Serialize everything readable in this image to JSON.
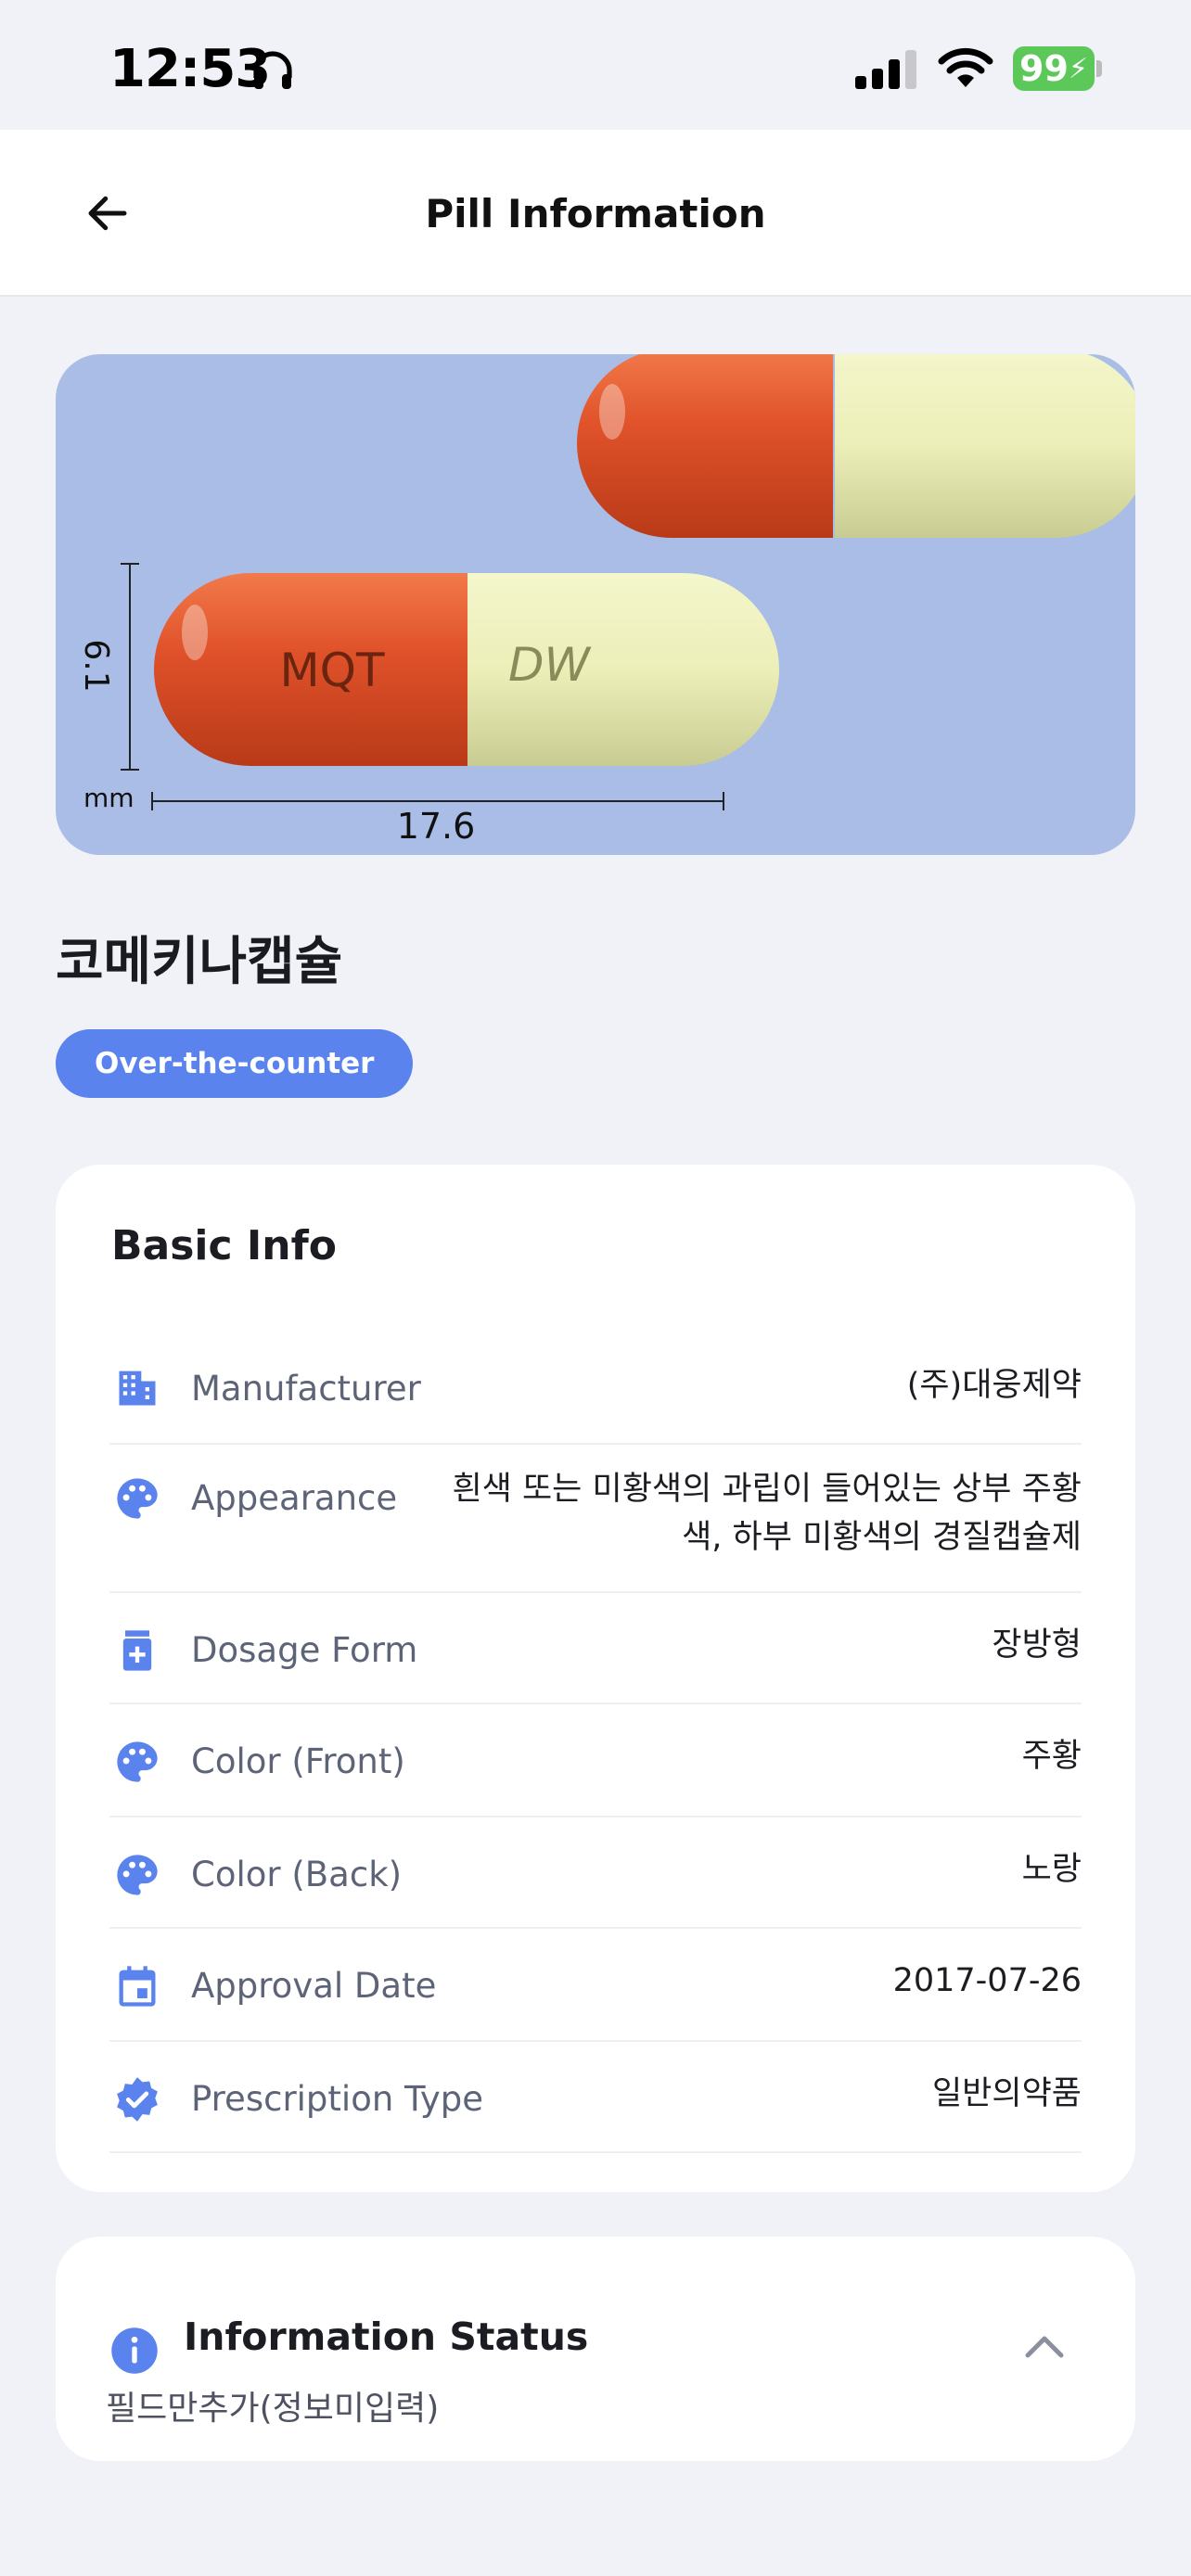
{
  "status_bar": {
    "time": "12:53",
    "battery": "99"
  },
  "nav": {
    "title": "Pill Information"
  },
  "pill_image": {
    "front_imprint": "MQT",
    "back_imprint": "DW",
    "height_dim": "6.1",
    "length_dim": "17.6",
    "unit": "mm",
    "color_front": "#e0522a",
    "color_back": "#ecefb8",
    "background": "#a9bde6"
  },
  "product": {
    "name": "코메키나캡슐",
    "badge": "Over-the-counter"
  },
  "basic_info": {
    "title": "Basic Info",
    "rows": [
      {
        "icon": "building-icon",
        "label": "Manufacturer",
        "value": "(주)대웅제약"
      },
      {
        "icon": "palette-icon",
        "label": "Appearance",
        "value_line1": "흰색 또는 미황색의 과립이 들어있는 상부 주황",
        "value_line2": "색, 하부 미황색의 경질캡슐제"
      },
      {
        "icon": "medicine-bottle-icon",
        "label": "Dosage Form",
        "value": "장방형"
      },
      {
        "icon": "palette-icon",
        "label": "Color (Front)",
        "value": "주황"
      },
      {
        "icon": "palette-icon",
        "label": "Color (Back)",
        "value": "노랑"
      },
      {
        "icon": "calendar-icon",
        "label": "Approval Date",
        "value": "2017-07-26"
      },
      {
        "icon": "verified-badge-icon",
        "label": "Prescription Type",
        "value": "일반의약품"
      }
    ]
  },
  "info_status": {
    "title": "Information Status",
    "text": "필드만추가(정보미입력)"
  },
  "colors": {
    "accent": "#5a83ee",
    "background": "#f1f2f7"
  }
}
